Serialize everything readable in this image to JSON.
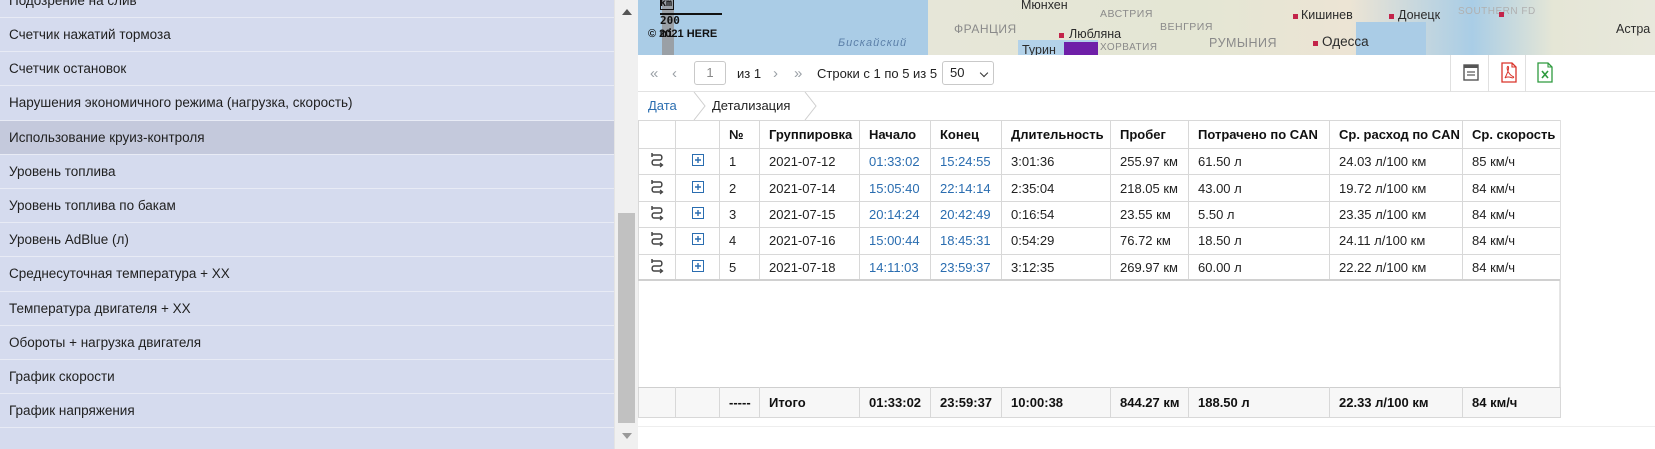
{
  "report_list": {
    "items": [
      {
        "label": "Подозрение на слив"
      },
      {
        "label": "Счетчик нажатий тормоза"
      },
      {
        "label": "Счетчик остановок"
      },
      {
        "label": "Нарушения экономичного режима (нагрузка, скорость)"
      },
      {
        "label": "Использование круиз-контроля",
        "active": true
      },
      {
        "label": "Уровень топлива"
      },
      {
        "label": "Уровень топлива по бакам"
      },
      {
        "label": "Уровень AdBlue (л)"
      },
      {
        "label": "Среднесуточная температура + ХХ"
      },
      {
        "label": "Температура двигателя + ХХ"
      },
      {
        "label": "Обороты + нагрузка двигателя"
      },
      {
        "label": "График скорости"
      },
      {
        "label": "График напряжения"
      }
    ]
  },
  "map": {
    "scale_km": "km",
    "scale_mi": "200 mi",
    "copyright": "© 2021 HERE",
    "labels": {
      "munich": "Мюнхен",
      "austria": "АВСТРИЯ",
      "hungary": "ВЕНГРИЯ",
      "chisinau": "Кишинев",
      "donetsk": "Донецк",
      "southern_fd": "SOUTHERN FD",
      "france": "ФРАНЦИЯ",
      "biscay": "Бискайский",
      "ljubljana": "Любляна",
      "croatia": "ХОРВАТИЯ",
      "romania": "РУМЫНИЯ",
      "odessa": "Одесса",
      "turin": "Турин",
      "astrakhan": "Астра"
    }
  },
  "toolbar": {
    "first_icon": "«",
    "prev_icon": "‹",
    "page": "1",
    "of_text": "из 1",
    "next_icon": "›",
    "last_icon": "»",
    "rows_text": "Строки с 1 по 5 из 5",
    "per_page": "50"
  },
  "breadcrumb": {
    "date": "Дата",
    "detail": "Детализация"
  },
  "table": {
    "headers": [
      "",
      "",
      "№",
      "Группировка",
      "Начало",
      "Конец",
      "Длительность",
      "Пробег",
      "Потрачено по CAN",
      "Ср. расход по CAN",
      "Ср. скорость"
    ],
    "rows": [
      {
        "n": "1",
        "date": "2021-07-12",
        "start": "01:33:02",
        "end": "15:24:55",
        "duration": "3:01:36",
        "mileage": "255.97 км",
        "can_spent": "61.50 л",
        "can_avg": "24.03 л/100 км",
        "speed": "85 км/ч"
      },
      {
        "n": "2",
        "date": "2021-07-14",
        "start": "15:05:40",
        "end": "22:14:14",
        "duration": "2:35:04",
        "mileage": "218.05 км",
        "can_spent": "43.00 л",
        "can_avg": "19.72 л/100 км",
        "speed": "84 км/ч"
      },
      {
        "n": "3",
        "date": "2021-07-15",
        "start": "20:14:24",
        "end": "20:42:49",
        "duration": "0:16:54",
        "mileage": "23.55 км",
        "can_spent": "5.50 л",
        "can_avg": "23.35 л/100 км",
        "speed": "84 км/ч"
      },
      {
        "n": "4",
        "date": "2021-07-16",
        "start": "15:00:44",
        "end": "18:45:31",
        "duration": "0:54:29",
        "mileage": "76.72 км",
        "can_spent": "18.50 л",
        "can_avg": "24.11 л/100 км",
        "speed": "84 км/ч"
      },
      {
        "n": "5",
        "date": "2021-07-18",
        "start": "14:11:03",
        "end": "23:59:37",
        "duration": "3:12:35",
        "mileage": "269.97 км",
        "can_spent": "60.00 л",
        "can_avg": "22.22 л/100 км",
        "speed": "84 км/ч"
      }
    ],
    "totals": {
      "n": "-----",
      "label": "Итого",
      "start": "01:33:02",
      "end": "23:59:37",
      "duration": "10:00:38",
      "mileage": "844.27 км",
      "can_spent": "188.50 л",
      "can_avg": "22.33 л/100 км",
      "speed": "84 км/ч"
    }
  },
  "icons": {
    "route": "route-icon",
    "expand": "expand-plus-icon",
    "print": "print-icon",
    "pdf": "pdf-export-icon",
    "excel": "excel-export-icon"
  },
  "colors": {
    "panel_bg": "#d5dbee",
    "active_item": "#c4c9dc",
    "link": "#2a6db0",
    "pdf_red": "#d9342b",
    "excel_green": "#2e9a3e"
  }
}
